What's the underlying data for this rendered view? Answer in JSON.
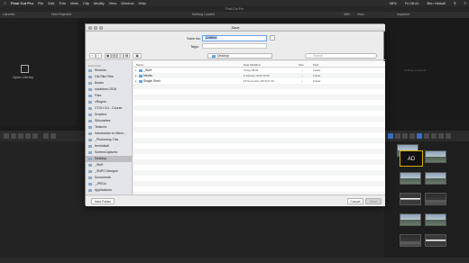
{
  "menubar": {
    "items": [
      "Final Cut Pro",
      "File",
      "Edit",
      "Trim",
      "Mark",
      "Clip",
      "Modify",
      "View",
      "Window",
      "Help"
    ],
    "status": {
      "battery": "98%",
      "clock": "Fri 08:41",
      "user": "Ben Halsall"
    }
  },
  "fcp": {
    "window_title": "Final Cut Pro",
    "libraries_label": "Libraries",
    "filter_label": "Hide Rejected",
    "nothing_loaded": "Nothing Loaded",
    "zoom": "38%",
    "view_label": "View",
    "inspector_label": "Inspector",
    "open_library": "Open Library",
    "nothing_to_inspect": "Nothing to Inspect",
    "thumb_ad": "AD"
  },
  "dialog": {
    "title": "Save",
    "save_as_label": "Save As:",
    "save_as_value": "Untitled",
    "tags_label": "Tags:",
    "location": "Desktop",
    "search_placeholder": "Search",
    "sidebar_heading": "Favourites",
    "sidebar_items": [
      {
        "label": "Recents",
        "selected": false
      },
      {
        "label": "Old Site Files",
        "selected": false
      },
      {
        "label": "Books",
        "selected": false
      },
      {
        "label": "studiobox-2016",
        "selected": false
      },
      {
        "label": "Files",
        "selected": false
      },
      {
        "label": "cRegine",
        "selected": false
      },
      {
        "label": "CTCH 111 - Course",
        "selected": false
      },
      {
        "label": "Dropbox",
        "selected": false
      },
      {
        "label": "Silhouettes",
        "selected": false
      },
      {
        "label": "Textures",
        "selected": false
      },
      {
        "label": "Introduction to Micro...",
        "selected": false
      },
      {
        "label": "_Photoshop Tuts",
        "selected": false
      },
      {
        "label": "benhalsall",
        "selected": false
      },
      {
        "label": "ScreenCaptures",
        "selected": false
      },
      {
        "label": "Desktop",
        "selected": true
      },
      {
        "label": "_Stuff",
        "selected": false
      },
      {
        "label": "_SNPO Designs",
        "selected": false
      },
      {
        "label": "Documents",
        "selected": false
      },
      {
        "label": "_JPEGs",
        "selected": false
      },
      {
        "label": "Applications",
        "selected": false
      }
    ],
    "columns": [
      "Name",
      "Date Modified",
      "Size",
      "Kind"
    ],
    "files": [
      {
        "name": "_Stuff",
        "date": "Today 08:36",
        "size": "--",
        "kind": "Folder"
      },
      {
        "name": "Media",
        "date": "8 January 2019 16:06",
        "size": "--",
        "kind": "Folder"
      },
      {
        "name": "Single Shell",
        "date": "18 November 2019 07:46",
        "size": "--",
        "kind": "Folder"
      }
    ],
    "new_folder_label": "New Folder",
    "cancel_label": "Cancel",
    "save_label": "Save"
  }
}
